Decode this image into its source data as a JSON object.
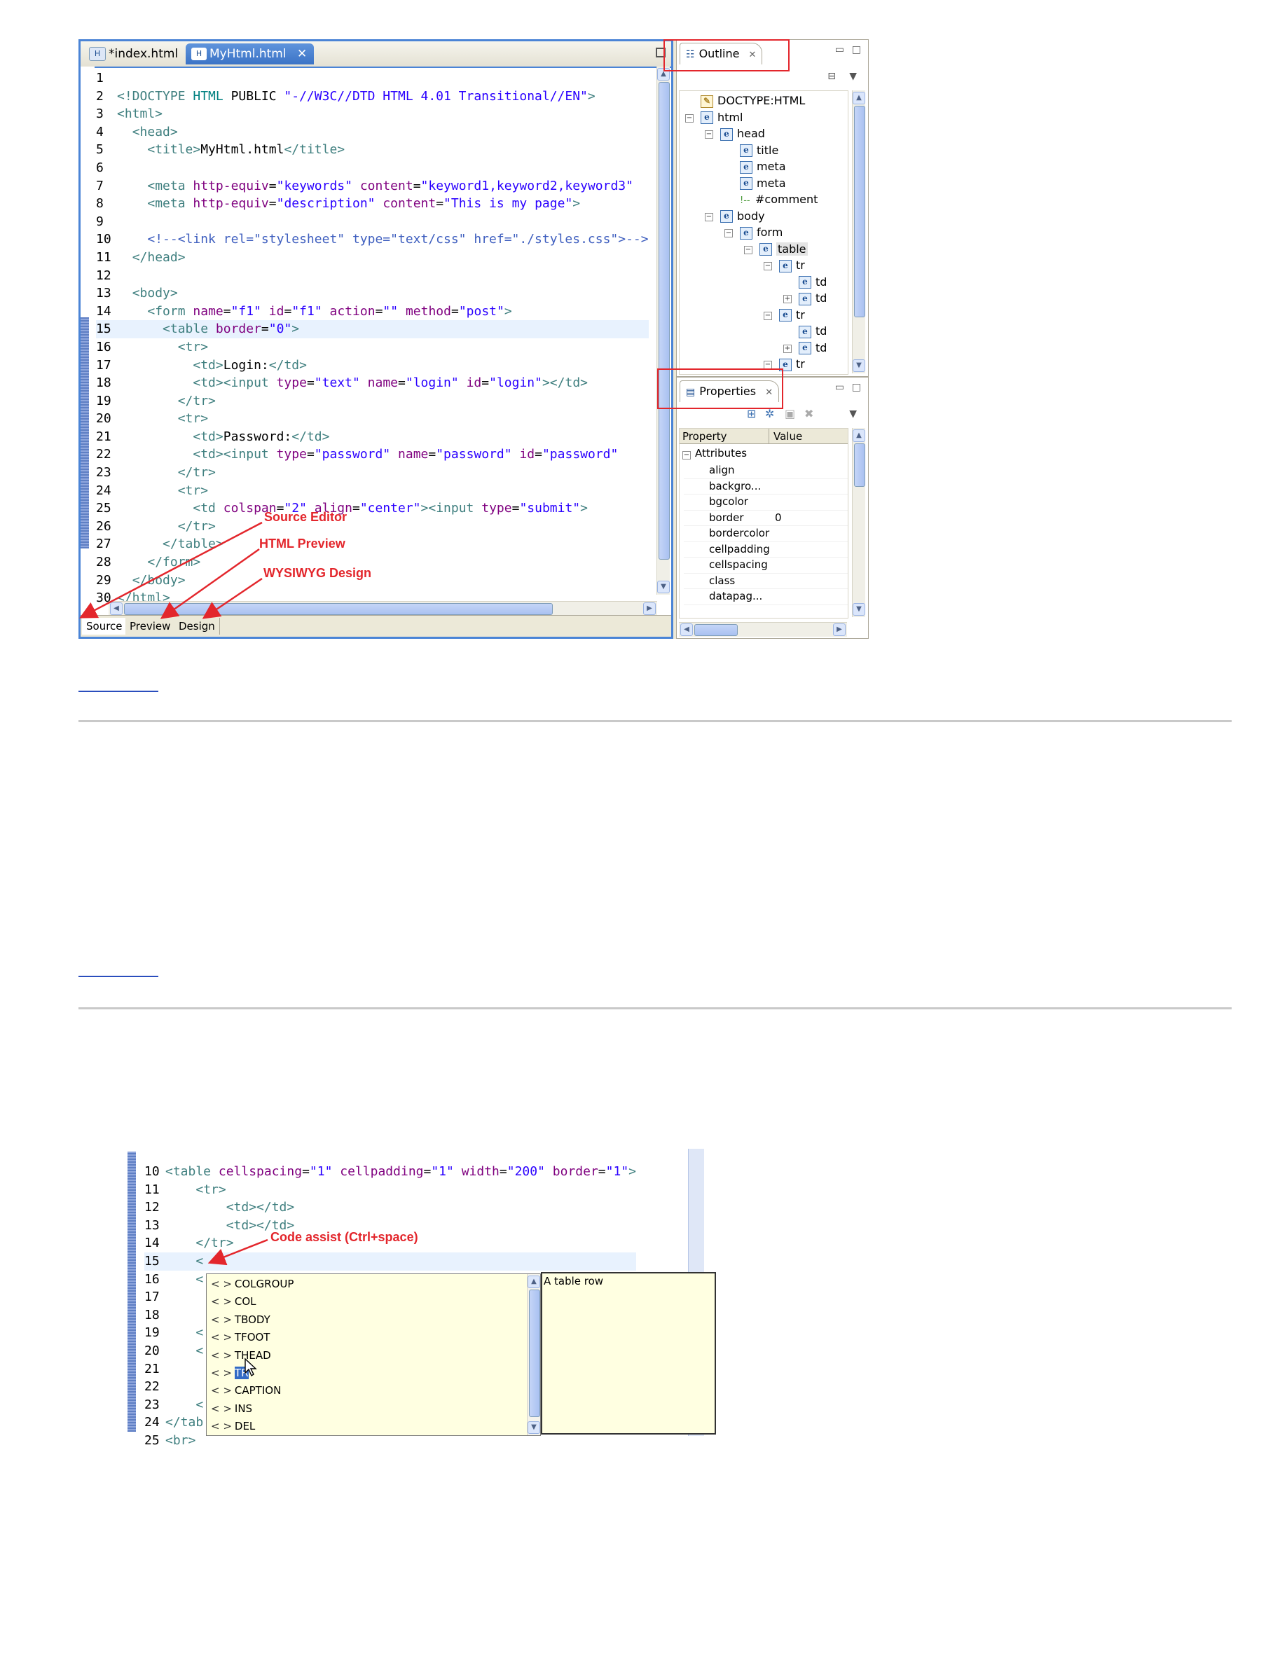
{
  "editor": {
    "tabs": [
      {
        "label": "*index.html",
        "icon": "html-file-icon",
        "active": false
      },
      {
        "label": "MyHtml.html",
        "icon": "html-file-icon",
        "active": true,
        "close": "✕"
      }
    ],
    "lines": [
      {
        "n": "1",
        "segs": []
      },
      {
        "n": "2",
        "segs": [
          [
            "tg",
            "<!DOCTYPE "
          ],
          [
            "dt",
            "HTML "
          ],
          [
            "tx",
            "PUBLIC "
          ],
          [
            "vl",
            "\"-//W3C//DTD HTML 4.01 Transitional//EN\""
          ],
          [
            "tg",
            ">"
          ]
        ]
      },
      {
        "n": "3",
        "segs": [
          [
            "tg",
            "<html>"
          ]
        ]
      },
      {
        "n": "4",
        "segs": [
          [
            "tx",
            "  "
          ],
          [
            "tg",
            "<head>"
          ]
        ]
      },
      {
        "n": "5",
        "segs": [
          [
            "tx",
            "    "
          ],
          [
            "tg",
            "<title>"
          ],
          [
            "tx",
            "MyHtml.html"
          ],
          [
            "tg",
            "</title>"
          ]
        ]
      },
      {
        "n": "6",
        "segs": []
      },
      {
        "n": "7",
        "segs": [
          [
            "tx",
            "    "
          ],
          [
            "tg",
            "<meta "
          ],
          [
            "at",
            "http-equiv"
          ],
          [
            "tx",
            "="
          ],
          [
            "vl",
            "\"keywords\""
          ],
          [
            "tx",
            " "
          ],
          [
            "at",
            "content"
          ],
          [
            "tx",
            "="
          ],
          [
            "vl",
            "\"keyword1,keyword2,keyword3\""
          ]
        ]
      },
      {
        "n": "8",
        "segs": [
          [
            "tx",
            "    "
          ],
          [
            "tg",
            "<meta "
          ],
          [
            "at",
            "http-equiv"
          ],
          [
            "tx",
            "="
          ],
          [
            "vl",
            "\"description\""
          ],
          [
            "tx",
            " "
          ],
          [
            "at",
            "content"
          ],
          [
            "tx",
            "="
          ],
          [
            "vl",
            "\"This is my page\""
          ],
          [
            "tg",
            ">"
          ]
        ]
      },
      {
        "n": "9",
        "segs": []
      },
      {
        "n": "10",
        "segs": [
          [
            "tx",
            "    "
          ],
          [
            "cm",
            "<!--<link rel=\"stylesheet\" type=\"text/css\" href=\"./styles.css\">-->"
          ]
        ]
      },
      {
        "n": "11",
        "segs": [
          [
            "tx",
            "  "
          ],
          [
            "tg",
            "</head>"
          ]
        ]
      },
      {
        "n": "12",
        "segs": []
      },
      {
        "n": "13",
        "segs": [
          [
            "tx",
            "  "
          ],
          [
            "tg",
            "<body>"
          ]
        ]
      },
      {
        "n": "14",
        "segs": [
          [
            "tx",
            "    "
          ],
          [
            "tg",
            "<form "
          ],
          [
            "at",
            "name"
          ],
          [
            "tx",
            "="
          ],
          [
            "vl",
            "\"f1\""
          ],
          [
            "tx",
            " "
          ],
          [
            "at",
            "id"
          ],
          [
            "tx",
            "="
          ],
          [
            "vl",
            "\"f1\""
          ],
          [
            "tx",
            " "
          ],
          [
            "at",
            "action"
          ],
          [
            "tx",
            "="
          ],
          [
            "vl",
            "\"\""
          ],
          [
            "tx",
            " "
          ],
          [
            "at",
            "method"
          ],
          [
            "tx",
            "="
          ],
          [
            "vl",
            "\"post\""
          ],
          [
            "tg",
            ">"
          ]
        ]
      },
      {
        "n": "15",
        "segs": [
          [
            "tx",
            "      "
          ],
          [
            "tg",
            "<table "
          ],
          [
            "at",
            "border"
          ],
          [
            "tx",
            "="
          ],
          [
            "vl",
            "\"0\""
          ],
          [
            "tg",
            ">"
          ]
        ],
        "cur": true
      },
      {
        "n": "16",
        "segs": [
          [
            "tx",
            "        "
          ],
          [
            "tg",
            "<tr>"
          ]
        ]
      },
      {
        "n": "17",
        "segs": [
          [
            "tx",
            "          "
          ],
          [
            "tg",
            "<td>"
          ],
          [
            "tx",
            "Login:"
          ],
          [
            "tg",
            "</td>"
          ]
        ]
      },
      {
        "n": "18",
        "segs": [
          [
            "tx",
            "          "
          ],
          [
            "tg",
            "<td><input "
          ],
          [
            "at",
            "type"
          ],
          [
            "tx",
            "="
          ],
          [
            "vl",
            "\"text\""
          ],
          [
            "tx",
            " "
          ],
          [
            "at",
            "name"
          ],
          [
            "tx",
            "="
          ],
          [
            "vl",
            "\"login\""
          ],
          [
            "tx",
            " "
          ],
          [
            "at",
            "id"
          ],
          [
            "tx",
            "="
          ],
          [
            "vl",
            "\"login\""
          ],
          [
            "tg",
            "></td>"
          ]
        ]
      },
      {
        "n": "19",
        "segs": [
          [
            "tx",
            "        "
          ],
          [
            "tg",
            "</tr>"
          ]
        ]
      },
      {
        "n": "20",
        "segs": [
          [
            "tx",
            "        "
          ],
          [
            "tg",
            "<tr>"
          ]
        ]
      },
      {
        "n": "21",
        "segs": [
          [
            "tx",
            "          "
          ],
          [
            "tg",
            "<td>"
          ],
          [
            "tx",
            "Password:"
          ],
          [
            "tg",
            "</td>"
          ]
        ]
      },
      {
        "n": "22",
        "segs": [
          [
            "tx",
            "          "
          ],
          [
            "tg",
            "<td><input "
          ],
          [
            "at",
            "type"
          ],
          [
            "tx",
            "="
          ],
          [
            "vl",
            "\"password\""
          ],
          [
            "tx",
            " "
          ],
          [
            "at",
            "name"
          ],
          [
            "tx",
            "="
          ],
          [
            "vl",
            "\"password\""
          ],
          [
            "tx",
            " "
          ],
          [
            "at",
            "id"
          ],
          [
            "tx",
            "="
          ],
          [
            "vl",
            "\"password\""
          ]
        ]
      },
      {
        "n": "23",
        "segs": [
          [
            "tx",
            "        "
          ],
          [
            "tg",
            "</tr>"
          ]
        ]
      },
      {
        "n": "24",
        "segs": [
          [
            "tx",
            "        "
          ],
          [
            "tg",
            "<tr>"
          ]
        ]
      },
      {
        "n": "25",
        "segs": [
          [
            "tx",
            "          "
          ],
          [
            "tg",
            "<td "
          ],
          [
            "at",
            "colspan"
          ],
          [
            "tx",
            "="
          ],
          [
            "vl",
            "\"2\""
          ],
          [
            "tx",
            " "
          ],
          [
            "at",
            "align"
          ],
          [
            "tx",
            "="
          ],
          [
            "vl",
            "\"center\""
          ],
          [
            "tg",
            "><input "
          ],
          [
            "at",
            "type"
          ],
          [
            "tx",
            "="
          ],
          [
            "vl",
            "\"submit\""
          ],
          [
            "tg",
            ">"
          ]
        ]
      },
      {
        "n": "26",
        "segs": [
          [
            "tx",
            "        "
          ],
          [
            "tg",
            "</tr>"
          ]
        ]
      },
      {
        "n": "27",
        "segs": [
          [
            "tx",
            "      "
          ],
          [
            "tg",
            "</table>"
          ]
        ]
      },
      {
        "n": "28",
        "segs": [
          [
            "tx",
            "    "
          ],
          [
            "tg",
            "</form>"
          ]
        ]
      },
      {
        "n": "29",
        "segs": [
          [
            "tx",
            "  "
          ],
          [
            "tg",
            "</body>"
          ]
        ]
      },
      {
        "n": "30",
        "segs": [
          [
            "tg",
            "</html>"
          ]
        ]
      }
    ],
    "bottom_tabs": [
      "Source",
      "Preview",
      "Design"
    ]
  },
  "annotations": {
    "source_editor": "Source Editor",
    "html_preview": "HTML Preview",
    "wysiwyg_design": "WYSIWYG Design",
    "code_assist": "Code assist (Ctrl+space)",
    "color": "#e3262c"
  },
  "outline": {
    "tab_label": "Outline",
    "close": "✕",
    "tree": [
      {
        "label": "DOCTYPE:HTML",
        "depth": 0,
        "icon": "doctype-icon"
      },
      {
        "label": "html",
        "depth": 0,
        "icon": "element-icon",
        "exp": "−"
      },
      {
        "label": "head",
        "depth": 1,
        "icon": "element-icon",
        "exp": "−"
      },
      {
        "label": "title",
        "depth": 2,
        "icon": "element-icon"
      },
      {
        "label": "meta",
        "depth": 2,
        "icon": "element-icon"
      },
      {
        "label": "meta",
        "depth": 2,
        "icon": "element-icon"
      },
      {
        "label": "#comment",
        "depth": 2,
        "icon": "comment-icon"
      },
      {
        "label": "body",
        "depth": 1,
        "icon": "element-icon",
        "exp": "−"
      },
      {
        "label": "form",
        "depth": 2,
        "icon": "element-icon",
        "exp": "−"
      },
      {
        "label": "table",
        "depth": 3,
        "icon": "element-icon",
        "exp": "−",
        "selected": true
      },
      {
        "label": "tr",
        "depth": 4,
        "icon": "element-icon",
        "exp": "−"
      },
      {
        "label": "td",
        "depth": 5,
        "icon": "element-icon"
      },
      {
        "label": "td",
        "depth": 5,
        "icon": "element-icon",
        "exp": "+"
      },
      {
        "label": "tr",
        "depth": 4,
        "icon": "element-icon",
        "exp": "−"
      },
      {
        "label": "td",
        "depth": 5,
        "icon": "element-icon"
      },
      {
        "label": "td",
        "depth": 5,
        "icon": "element-icon",
        "exp": "+"
      },
      {
        "label": "tr",
        "depth": 4,
        "icon": "element-icon",
        "exp": "−"
      }
    ]
  },
  "properties": {
    "tab_label": "Properties",
    "close": "✕",
    "col_property": "Property",
    "col_value": "Value",
    "group": "Attributes",
    "rows": [
      {
        "name": "align",
        "value": ""
      },
      {
        "name": "backgro...",
        "value": ""
      },
      {
        "name": "bgcolor",
        "value": ""
      },
      {
        "name": "border",
        "value": "0"
      },
      {
        "name": "bordercolor",
        "value": ""
      },
      {
        "name": "cellpadding",
        "value": ""
      },
      {
        "name": "cellspacing",
        "value": ""
      },
      {
        "name": "class",
        "value": ""
      },
      {
        "name": "datapag...",
        "value": ""
      }
    ]
  },
  "assist": {
    "lines": [
      {
        "n": "10",
        "segs": [
          [
            "tg",
            "<table "
          ],
          [
            "at",
            "cellspacing"
          ],
          [
            "tx",
            "="
          ],
          [
            "vl",
            "\"1\""
          ],
          [
            "tx",
            " "
          ],
          [
            "at",
            "cellpadding"
          ],
          [
            "tx",
            "="
          ],
          [
            "vl",
            "\"1\""
          ],
          [
            "tx",
            " "
          ],
          [
            "at",
            "width"
          ],
          [
            "tx",
            "="
          ],
          [
            "vl",
            "\"200\""
          ],
          [
            "tx",
            " "
          ],
          [
            "at",
            "border"
          ],
          [
            "tx",
            "="
          ],
          [
            "vl",
            "\"1\""
          ],
          [
            "tg",
            ">"
          ]
        ]
      },
      {
        "n": "11",
        "segs": [
          [
            "tx",
            "    "
          ],
          [
            "tg",
            "<tr>"
          ]
        ]
      },
      {
        "n": "12",
        "segs": [
          [
            "tx",
            "        "
          ],
          [
            "tg",
            "<td></td>"
          ]
        ]
      },
      {
        "n": "13",
        "segs": [
          [
            "tx",
            "        "
          ],
          [
            "tg",
            "<td></td>"
          ]
        ]
      },
      {
        "n": "14",
        "segs": [
          [
            "tx",
            "    "
          ],
          [
            "tg",
            "</tr>"
          ]
        ]
      },
      {
        "n": "15",
        "segs": [
          [
            "tx",
            "    "
          ],
          [
            "tg",
            "<"
          ]
        ],
        "cur": true
      },
      {
        "n": "16",
        "segs": [
          [
            "tx",
            "    "
          ],
          [
            "tg",
            "<"
          ]
        ]
      },
      {
        "n": "17",
        "segs": []
      },
      {
        "n": "18",
        "segs": []
      },
      {
        "n": "19",
        "segs": [
          [
            "tx",
            "    "
          ],
          [
            "tg",
            "<"
          ]
        ]
      },
      {
        "n": "20",
        "segs": [
          [
            "tx",
            "    "
          ],
          [
            "tg",
            "<"
          ]
        ]
      },
      {
        "n": "21",
        "segs": []
      },
      {
        "n": "22",
        "segs": []
      },
      {
        "n": "23",
        "segs": [
          [
            "tx",
            "    "
          ],
          [
            "tg",
            "<"
          ]
        ]
      },
      {
        "n": "24",
        "segs": [
          [
            "tg",
            "</tab"
          ]
        ]
      },
      {
        "n": "25",
        "segs": [
          [
            "tg",
            "<br>"
          ]
        ]
      }
    ],
    "proposals": [
      {
        "label": "COLGROUP"
      },
      {
        "label": "COL"
      },
      {
        "label": "TBODY"
      },
      {
        "label": "TFOOT"
      },
      {
        "label": "THEAD"
      },
      {
        "label": "TR",
        "selected": true
      },
      {
        "label": "CAPTION"
      },
      {
        "label": "INS"
      },
      {
        "label": "DEL"
      }
    ],
    "bracket": "< >",
    "doc": "A table row"
  }
}
